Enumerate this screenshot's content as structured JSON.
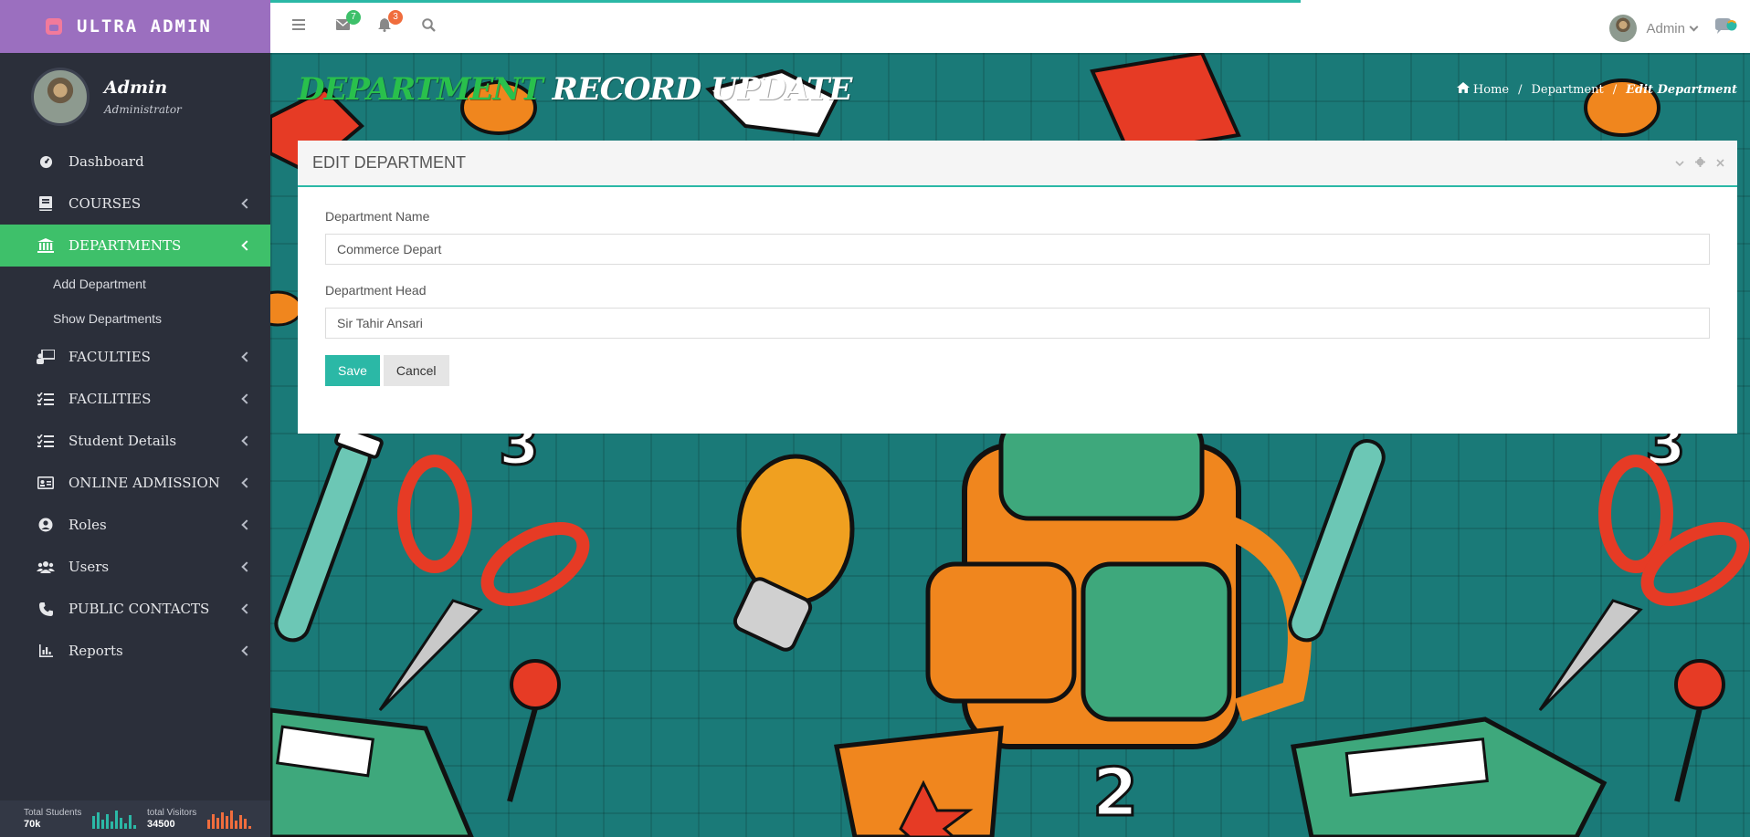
{
  "brand": {
    "name": "ULTRA ADMIN",
    "logo_icon": "database-icon",
    "color": "#9b6fbf"
  },
  "profile": {
    "name": "Admin",
    "role": "Administrator"
  },
  "sidebar": {
    "items": [
      {
        "label": "Dashboard",
        "icon": "dashboard-icon"
      },
      {
        "label": "COURSES",
        "icon": "book-icon"
      },
      {
        "label": "DEPARTMENTS",
        "icon": "bank-icon",
        "active": true
      },
      {
        "label": "FACULTIES",
        "icon": "teacher-icon"
      },
      {
        "label": "FACILITIES",
        "icon": "list-icon"
      },
      {
        "label": "Student Details",
        "icon": "list-icon"
      },
      {
        "label": "ONLINE ADMISSION",
        "icon": "id-card-icon"
      },
      {
        "label": "Roles",
        "icon": "user-circle-icon"
      },
      {
        "label": "Users",
        "icon": "users-icon"
      },
      {
        "label": "PUBLIC CONTACTS",
        "icon": "phone-icon"
      },
      {
        "label": "Reports",
        "icon": "bar-chart-icon"
      }
    ],
    "subitems": [
      {
        "label": "Add Department"
      },
      {
        "label": "Show Departments"
      }
    ],
    "active_color": "#3ec06a"
  },
  "footer_stats": [
    {
      "label": "Total Students",
      "value": "70k",
      "color": "#2bb8a6"
    },
    {
      "label": "total Visitors",
      "value": "34500",
      "color": "#f06d3d"
    }
  ],
  "topbar": {
    "messages_badge": "7",
    "notifications_badge": "3",
    "user_name": "Admin",
    "icons": [
      "menu-icon",
      "envelope-icon",
      "bell-icon",
      "search-icon",
      "chat-icon"
    ]
  },
  "page": {
    "title_part1": "DEPARTMENT",
    "title_part2": "RECORD UPDATE"
  },
  "breadcrumb": {
    "home": "Home",
    "section": "Department",
    "current": "Edit Department"
  },
  "panel": {
    "title": "EDIT DEPARTMENT",
    "fields": {
      "name_label": "Department Name",
      "name_value": "Commerce Depart",
      "head_label": "Department Head",
      "head_value": "Sir Tahir Ansari"
    },
    "save_label": "Save",
    "cancel_label": "Cancel",
    "accent": "#2bb8a6"
  }
}
